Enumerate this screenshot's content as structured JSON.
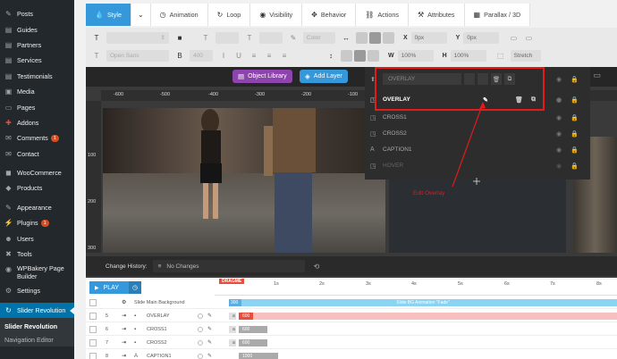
{
  "sidebar": {
    "items": [
      {
        "label": "Posts",
        "icon": "pin-icon"
      },
      {
        "label": "Guides",
        "icon": "guides-icon"
      },
      {
        "label": "Partners",
        "icon": "partners-icon"
      },
      {
        "label": "Services",
        "icon": "services-icon"
      },
      {
        "label": "Testimonials",
        "icon": "testimonials-icon"
      },
      {
        "label": "Media",
        "icon": "media-icon"
      },
      {
        "label": "Pages",
        "icon": "pages-icon"
      },
      {
        "label": "Addons",
        "icon": "addons-icon"
      },
      {
        "label": "Comments",
        "icon": "comments-icon",
        "badge": "1"
      },
      {
        "label": "Contact",
        "icon": "contact-icon"
      },
      {
        "label": "WooCommerce",
        "icon": "woocommerce-icon"
      },
      {
        "label": "Products",
        "icon": "products-icon"
      },
      {
        "label": "Appearance",
        "icon": "appearance-icon"
      },
      {
        "label": "Plugins",
        "icon": "plugins-icon",
        "badge": "1"
      },
      {
        "label": "Users",
        "icon": "users-icon"
      },
      {
        "label": "Tools",
        "icon": "tools-icon"
      },
      {
        "label": "WPBakery Page Builder",
        "icon": "wpbakery-icon"
      },
      {
        "label": "Settings",
        "icon": "settings-icon"
      },
      {
        "label": "Slider Revolution",
        "icon": "slider-revolution-icon"
      }
    ],
    "submenu": [
      "Slider Revolution",
      "Navigation Editor"
    ]
  },
  "tabs": [
    {
      "label": "Style",
      "icon": "droplet-icon",
      "active": true
    },
    {
      "label": "",
      "icon": "chevron-down-icon"
    },
    {
      "label": "Animation",
      "icon": "animation-icon"
    },
    {
      "label": "Loop",
      "icon": "loop-icon"
    },
    {
      "label": "Visibility",
      "icon": "eye-icon"
    },
    {
      "label": "Behavior",
      "icon": "behavior-icon"
    },
    {
      "label": "Actions",
      "icon": "link-icon"
    },
    {
      "label": "Attributes",
      "icon": "wrench-icon"
    },
    {
      "label": "Parallax / 3D",
      "icon": "image-icon"
    }
  ],
  "toolbar": {
    "font_family": "Open Sans",
    "font_weight": "400",
    "color_placeholder": "Color",
    "x_label": "X",
    "x_value": "0px",
    "y_label": "Y",
    "y_value": "0px",
    "w_label": "W",
    "w_value": "100%",
    "h_label": "H",
    "h_value": "100%",
    "stretch_value": "Stretch"
  },
  "stage": {
    "object_library": "Object Library",
    "add_layer": "Add Layer",
    "ruler_h": [
      "-600",
      "-500",
      "-400",
      "-300",
      "-200",
      "-100"
    ],
    "ruler_v": [
      "100",
      "200",
      "300"
    ],
    "change_history_label": "Change History:",
    "change_history_value": "No Changes"
  },
  "layers": {
    "top_name": "OVERLAY",
    "rows": [
      {
        "name": "OVERLAY",
        "icon": "layer-icon"
      },
      {
        "name": "CROSS1",
        "icon": "layer-icon"
      },
      {
        "name": "CROSS2",
        "icon": "layer-icon"
      },
      {
        "name": "CAPTION1",
        "icon": "text-icon"
      },
      {
        "name": "HOVER",
        "icon": "layer-icon"
      }
    ]
  },
  "annotation": "Edit Overlay",
  "timeline": {
    "play_label": "PLAY",
    "dragme": "DRAGME",
    "seconds": [
      "1s",
      "2s",
      "3s",
      "4s",
      "5s",
      "6s",
      "7s",
      "8s"
    ],
    "bg_label": "Slide Main Background",
    "bg_start": "300",
    "bg_anim": "Slide BG Animation \"Fade\"",
    "rows": [
      {
        "num": "5",
        "name": "OVERLAY",
        "duration": "600",
        "bar": "pink"
      },
      {
        "num": "6",
        "name": "CROSS1",
        "duration": "600",
        "bar": "gray"
      },
      {
        "num": "7",
        "name": "CROSS2",
        "duration": "600",
        "bar": "gray"
      },
      {
        "num": "8",
        "name": "CAPTION1",
        "duration": "1000",
        "bar": "gray"
      }
    ]
  },
  "colors": {
    "sidebar_bg": "#23282d",
    "active_blue": "#0073aa",
    "tab_active": "#3498db",
    "annotation_red": "#e21b1b"
  }
}
